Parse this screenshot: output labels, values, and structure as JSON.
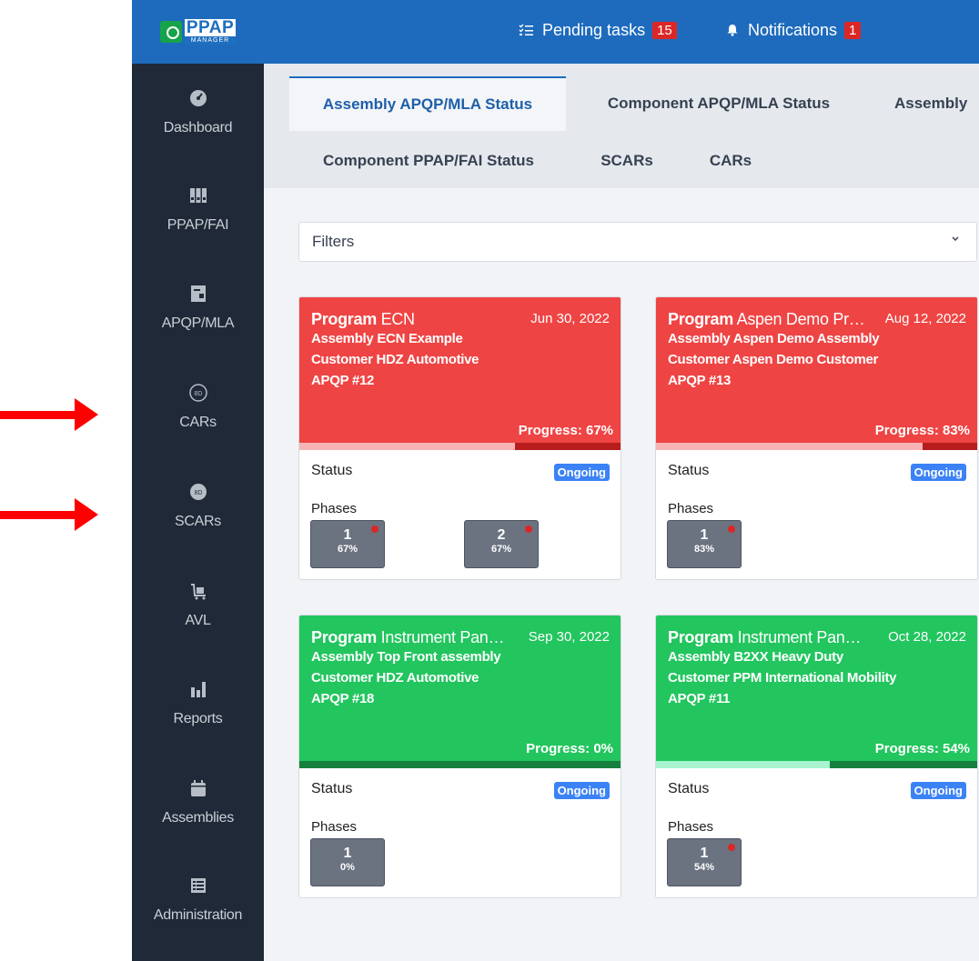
{
  "logo": {
    "main": "PPAP",
    "sub": "MANAGER"
  },
  "sidebar": {
    "items": [
      {
        "label": "Dashboard",
        "icon": "speedometer-icon"
      },
      {
        "label": "PPAP/FAI",
        "icon": "binders-icon"
      },
      {
        "label": "APQP/MLA",
        "icon": "document-icon"
      },
      {
        "label": "CARs",
        "icon": "8d-circle-icon"
      },
      {
        "label": "SCARs",
        "icon": "8d-badge-icon"
      },
      {
        "label": "AVL",
        "icon": "cart-icon"
      },
      {
        "label": "Reports",
        "icon": "bar-chart-icon"
      },
      {
        "label": "Assemblies",
        "icon": "calendar-icon"
      },
      {
        "label": "Administration",
        "icon": "table-icon"
      }
    ]
  },
  "header": {
    "pending_label": "Pending tasks",
    "pending_count": "15",
    "notifications_label": "Notifications",
    "notifications_count": "1"
  },
  "tabs": {
    "row1": [
      "Assembly APQP/MLA Status",
      "Component APQP/MLA Status",
      "Assembly"
    ],
    "row2": [
      "Component PPAP/FAI Status",
      "SCARs",
      "CARs"
    ],
    "active": "Assembly APQP/MLA Status"
  },
  "filters": {
    "label": "Filters"
  },
  "cards": [
    {
      "program_word": "Program",
      "program": "ECN",
      "date": "Jun 30, 2022",
      "assembly": "Assembly ECN Example",
      "customer": "Customer HDZ Automotive",
      "apqp": "APQP #12",
      "progress_text": "Progress: 67%",
      "progress": 0.67,
      "status_label": "Status",
      "status": "Ongoing",
      "phases_label": "Phases",
      "phases": [
        {
          "num": "1",
          "pct": "67%",
          "alert": true
        },
        {
          "num": "2",
          "pct": "67%",
          "alert": true
        }
      ],
      "color": "#ef4444"
    },
    {
      "program_word": "Program",
      "program": "Aspen Demo Pr…",
      "date": "Aug 12, 2022",
      "assembly": "Assembly Aspen Demo Assembly",
      "customer": "Customer Aspen Demo Customer",
      "apqp": "APQP #13",
      "progress_text": "Progress: 83%",
      "progress": 0.83,
      "status_label": "Status",
      "status": "Ongoing",
      "phases_label": "Phases",
      "phases": [
        {
          "num": "1",
          "pct": "83%",
          "alert": true
        }
      ],
      "color": "#ef4444"
    },
    {
      "program_word": "Program",
      "program": "Instrument Pan…",
      "date": "Sep 30, 2022",
      "assembly": "Assembly Top Front assembly",
      "customer": "Customer HDZ Automotive",
      "apqp": "APQP #18",
      "progress_text": "Progress: 0%",
      "progress": 0.0,
      "status_label": "Status",
      "status": "Ongoing",
      "phases_label": "Phases",
      "phases": [
        {
          "num": "1",
          "pct": "0%",
          "alert": false
        }
      ],
      "color": "#22c55e"
    },
    {
      "program_word": "Program",
      "program": "Instrument Pan…",
      "date": "Oct 28, 2022",
      "assembly": "Assembly B2XX Heavy Duty",
      "customer": "Customer PPM International Mobility",
      "apqp": "APQP #11",
      "progress_text": "Progress: 54%",
      "progress": 0.54,
      "status_label": "Status",
      "status": "Ongoing",
      "phases_label": "Phases",
      "phases": [
        {
          "num": "1",
          "pct": "54%",
          "alert": true
        }
      ],
      "color": "#22c55e"
    }
  ],
  "colors": {
    "header": "#1e6bbd",
    "sidebar": "#1f2937",
    "late": "#ef4444",
    "on_track": "#22c55e",
    "status_badge": "#3b82f6",
    "annotation_arrow": "#ff0000"
  }
}
